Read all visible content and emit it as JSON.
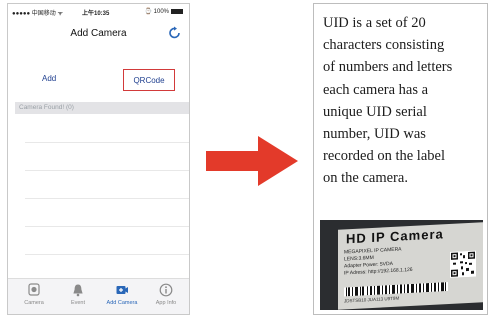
{
  "phone": {
    "status": {
      "carrier": "●●●●● 中国移动 ᯤ",
      "time": "上午10:35",
      "battery": "⌚ 100%"
    },
    "nav": {
      "title": "Add Camera",
      "refresh_icon": "refresh-icon"
    },
    "add_label": "Add",
    "qrcode_label": "QRCode",
    "found_label": "Camera Found! (0)",
    "tabs": [
      {
        "label": "Camera",
        "icon": "camera-icon"
      },
      {
        "label": "Event",
        "icon": "bell-icon"
      },
      {
        "label": "Add Camera",
        "icon": "add-camera-icon"
      },
      {
        "label": "App Info",
        "icon": "info-icon"
      }
    ],
    "accent": "#1f3f8f",
    "highlight": "#d23a3a"
  },
  "arrow": {
    "color": "#e33a2a"
  },
  "info": {
    "lines": [
      "UID is a set of 20",
      "characters consisting",
      "of numbers and letters",
      "each camera has a",
      "unique UID serial",
      "number, UID was",
      "recorded on the label",
      "on the camera."
    ]
  },
  "label": {
    "title": "HD IP Camera",
    "lines": [
      "MEGAPIXEL IP CAMERA",
      "LENS:3.6MM",
      "Adapter  Power: 5VDA",
      "IP Adress: http://192.168.1.126"
    ],
    "uid": "JDSTSB10  JUA113 U9T9M"
  }
}
